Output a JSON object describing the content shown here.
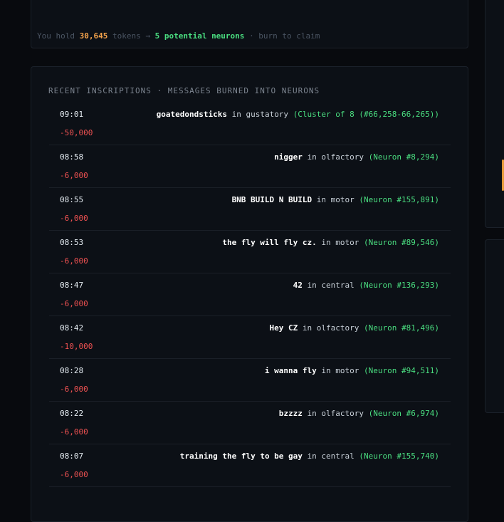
{
  "holdings": {
    "prefix": "You hold",
    "tokens": "30,645",
    "tokens_word": "tokens →",
    "neurons": "5 potential neurons",
    "suffix": "· burn to claim"
  },
  "recent": {
    "heading": "RECENT INSCRIPTIONS · MESSAGES BURNED INTO NEURONS",
    "items": [
      {
        "time": "09:01",
        "text": "goatedondsticks",
        "region": "gustatory",
        "ref": "(Cluster of 8 (#66,258-66,265))",
        "amount": "-50,000"
      },
      {
        "time": "08:58",
        "text": "nigger",
        "region": "olfactory",
        "ref": "(Neuron #8,294)",
        "amount": "-6,000"
      },
      {
        "time": "08:55",
        "text": "BNB BUILD N BUILD",
        "region": "motor",
        "ref": "(Neuron #155,891)",
        "amount": "-6,000"
      },
      {
        "time": "08:53",
        "text": "the fly will fly cz.",
        "region": "motor",
        "ref": "(Neuron #89,546)",
        "amount": "-6,000"
      },
      {
        "time": "08:47",
        "text": "42",
        "region": "central",
        "ref": "(Neuron #136,293)",
        "amount": "-6,000"
      },
      {
        "time": "08:42",
        "text": "Hey CZ",
        "region": "olfactory",
        "ref": "(Neuron #81,496)",
        "amount": "-10,000"
      },
      {
        "time": "08:28",
        "text": "i wanna fly",
        "region": "motor",
        "ref": "(Neuron #94,511)",
        "amount": "-6,000"
      },
      {
        "time": "08:22",
        "text": "bzzzz",
        "region": "olfactory",
        "ref": "(Neuron #6,974)",
        "amount": "-6,000"
      },
      {
        "time": "08:07",
        "text": "training the fly to be gay",
        "region": "central",
        "ref": "(Neuron #155,740)",
        "amount": "-6,000"
      }
    ],
    "in_word": "in"
  },
  "colors": {
    "accent_orange": "#f5a34b",
    "accent_green": "#4ade80",
    "negative_red": "#f05252"
  }
}
